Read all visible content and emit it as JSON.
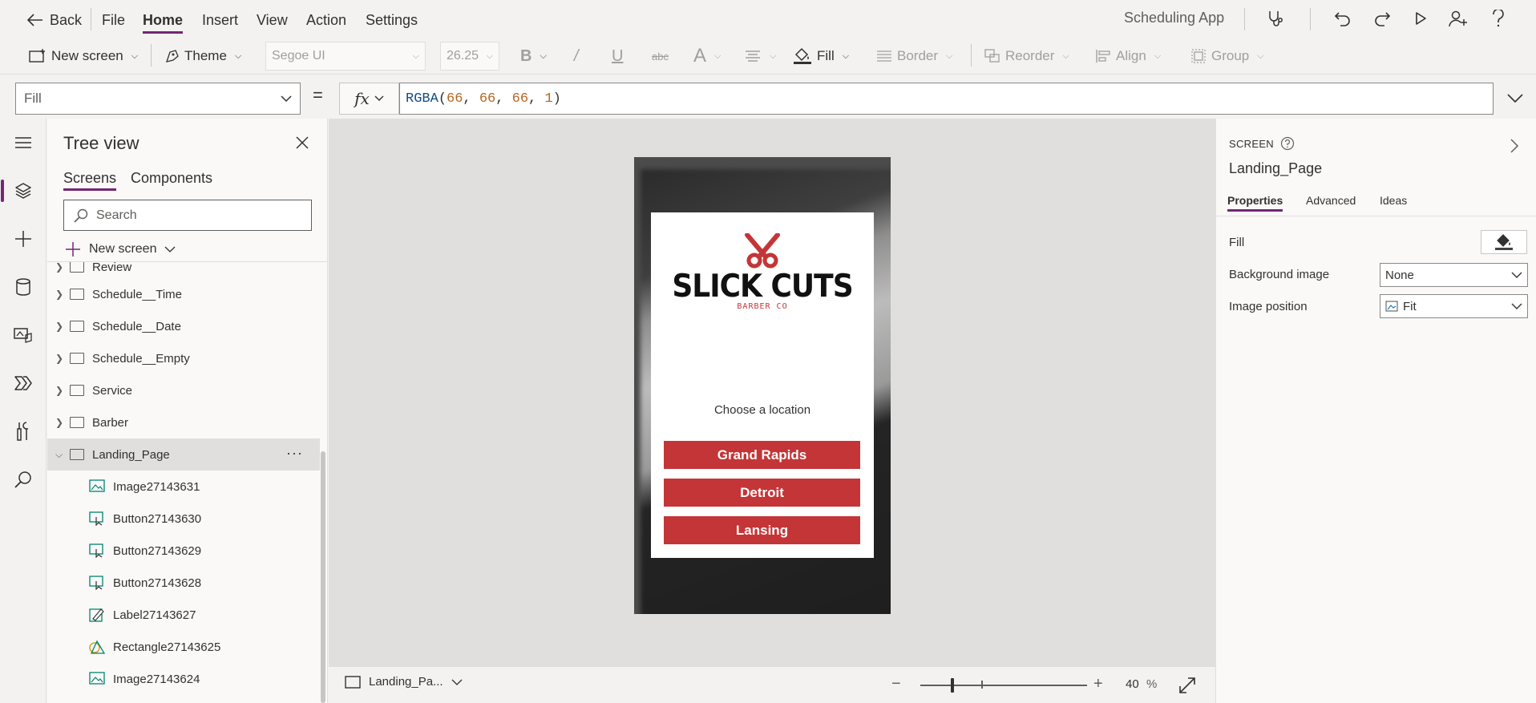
{
  "menubar": {
    "back_label": "Back",
    "items": [
      "File",
      "Home",
      "Insert",
      "View",
      "Action",
      "Settings"
    ],
    "active": "Home",
    "app_name": "Scheduling App",
    "icons": [
      "app-checker-icon",
      "undo-icon",
      "redo-icon",
      "play-icon",
      "share-icon",
      "help-icon"
    ]
  },
  "toolbar": {
    "new_screen": "New screen",
    "theme": "Theme",
    "font": "Segoe UI",
    "font_size": "26.25",
    "bold": "B",
    "italic": "/",
    "underline": "U",
    "strike": "abc",
    "font_color": "A",
    "fill": "Fill",
    "border": "Border",
    "reorder": "Reorder",
    "align": "Align",
    "group": "Group"
  },
  "formula": {
    "property": "Fill",
    "equals": "=",
    "fx": "fx",
    "fn_name": "RGBA",
    "args": [
      "66",
      "66",
      "66",
      "1"
    ]
  },
  "tree": {
    "title": "Tree view",
    "tabs": [
      "Screens",
      "Components"
    ],
    "active_tab": "Screens",
    "search_placeholder": "Search",
    "new_screen": "New screen",
    "screens": [
      {
        "name": "Review",
        "expanded": false
      },
      {
        "name": "Schedule__Time",
        "expanded": false
      },
      {
        "name": "Schedule__Date",
        "expanded": false
      },
      {
        "name": "Schedule__Empty",
        "expanded": false
      },
      {
        "name": "Service",
        "expanded": false
      },
      {
        "name": "Barber",
        "expanded": false
      },
      {
        "name": "Landing_Page",
        "expanded": true,
        "selected": true
      }
    ],
    "children": [
      {
        "name": "Image27143631",
        "type": "image"
      },
      {
        "name": "Button27143630",
        "type": "button"
      },
      {
        "name": "Button27143629",
        "type": "button"
      },
      {
        "name": "Button27143628",
        "type": "button"
      },
      {
        "name": "Label27143627",
        "type": "label"
      },
      {
        "name": "Rectangle27143625",
        "type": "shape"
      },
      {
        "name": "Image27143624",
        "type": "image"
      }
    ],
    "more": "···"
  },
  "canvas": {
    "logo_main": "SLICK CUTS",
    "logo_sub": "BARBER CO",
    "prompt": "Choose a location",
    "locations": [
      "Grand Rapids",
      "Detroit",
      "Lansing"
    ],
    "accent": "#c43537"
  },
  "footer": {
    "screen_label": "Landing_Pa...",
    "zoom": "40",
    "zoom_unit": "%",
    "zoom_minus": "−",
    "zoom_plus": "+"
  },
  "props": {
    "kind": "SCREEN",
    "name": "Landing_Page",
    "tabs": [
      "Properties",
      "Advanced",
      "Ideas"
    ],
    "active_tab": "Properties",
    "fill_label": "Fill",
    "bg_image_label": "Background image",
    "bg_image_value": "None",
    "img_pos_label": "Image position",
    "img_pos_value": "Fit"
  },
  "colors": {
    "brand": "#742774",
    "button": "#c43537",
    "canvas_bg": "#e1dfdd"
  }
}
